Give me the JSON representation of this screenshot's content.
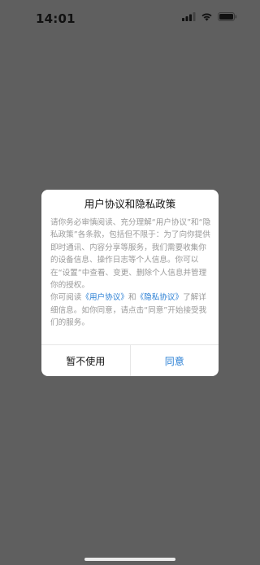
{
  "status_bar": {
    "time": "14:01"
  },
  "dialog": {
    "title": "用户协议和隐私政策",
    "paragraph1": "请你务必审慎阅读、充分理解“用户协议”和“隐私政策”各条款，包括但不限于：为了向你提供即时通讯、内容分享等服务，我们需要收集你的设备信息、操作日志等个人信息。你可以在“设置”中查看、变更、删除个人信息并管理你的授权。",
    "p2_prefix": "你可阅读",
    "user_agreement_link": "《用户协议》",
    "p2_and": "和",
    "privacy_link": "《隐私协议》",
    "p2_suffix": "了解详细信息。如你同意，请点击“同意”开始接受我们的服务。",
    "cancel_label": "暂不使用",
    "agree_label": "同意"
  },
  "colors": {
    "backdrop": "#5f5f5f",
    "link": "#2a7fd4",
    "body_text": "#9a9a9a"
  },
  "icons": {
    "signal": "cellular-signal-icon",
    "wifi": "wifi-icon",
    "battery": "battery-icon"
  }
}
